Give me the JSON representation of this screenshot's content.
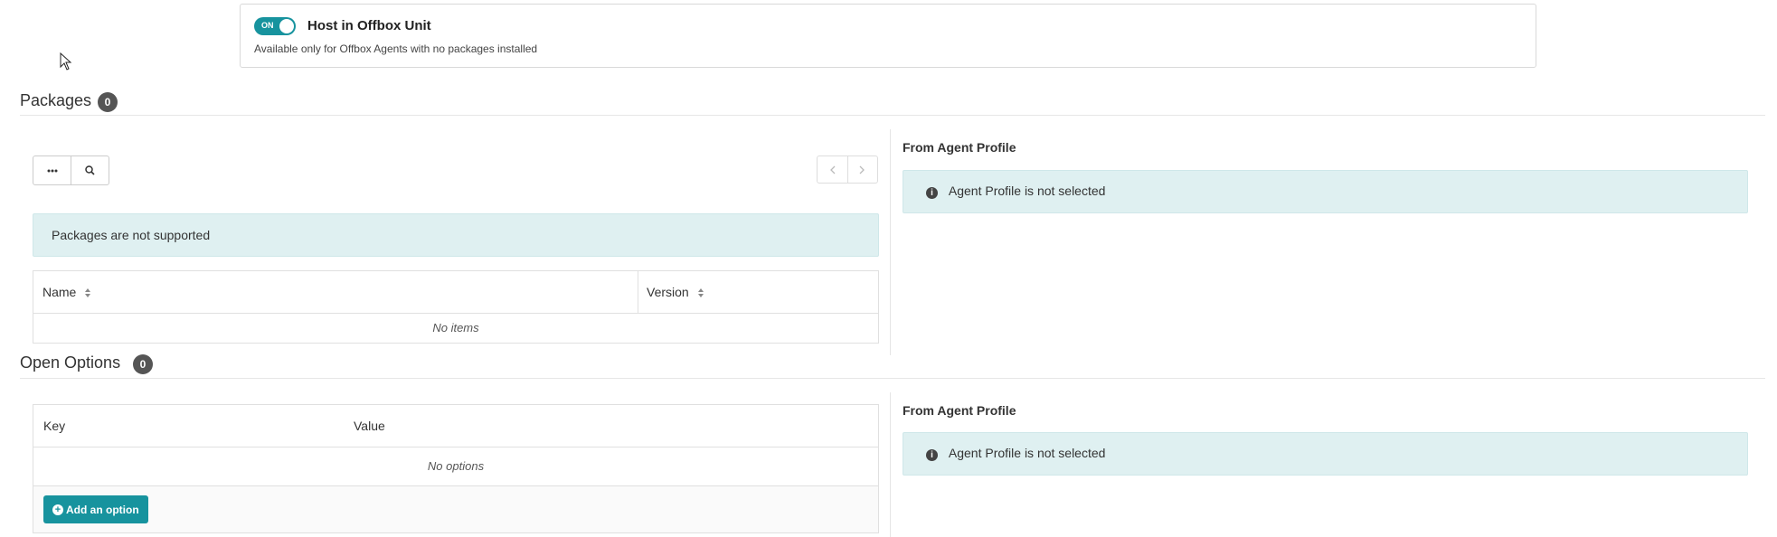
{
  "offbox": {
    "toggle_label": "ON",
    "toggle_state": "on",
    "title": "Host in Offbox Unit",
    "subtitle": "Available only for Offbox Agents with no packages installed"
  },
  "packages": {
    "title": "Packages",
    "count": "0",
    "notice": "Packages are not supported",
    "columns": [
      "Name",
      "Version"
    ],
    "empty_text": "No items",
    "profile_heading": "From Agent Profile",
    "profile_notice": "Agent Profile is not selected"
  },
  "open_options": {
    "title": "Open Options",
    "count": "0",
    "columns": [
      "Key",
      "Value"
    ],
    "empty_text": "No options",
    "add_button": "Add an option",
    "profile_heading": "From Agent Profile",
    "profile_notice": "Agent Profile is not selected"
  },
  "colors": {
    "accent": "#17939e",
    "info_bg": "#dff0f1",
    "badge": "#555555"
  },
  "icons": {
    "more": "ellipsis-icon",
    "search": "search-icon",
    "prev": "chevron-left-icon",
    "next": "chevron-right-icon",
    "sort": "sort-icon",
    "info": "info-icon",
    "add": "plus-circle-icon"
  }
}
